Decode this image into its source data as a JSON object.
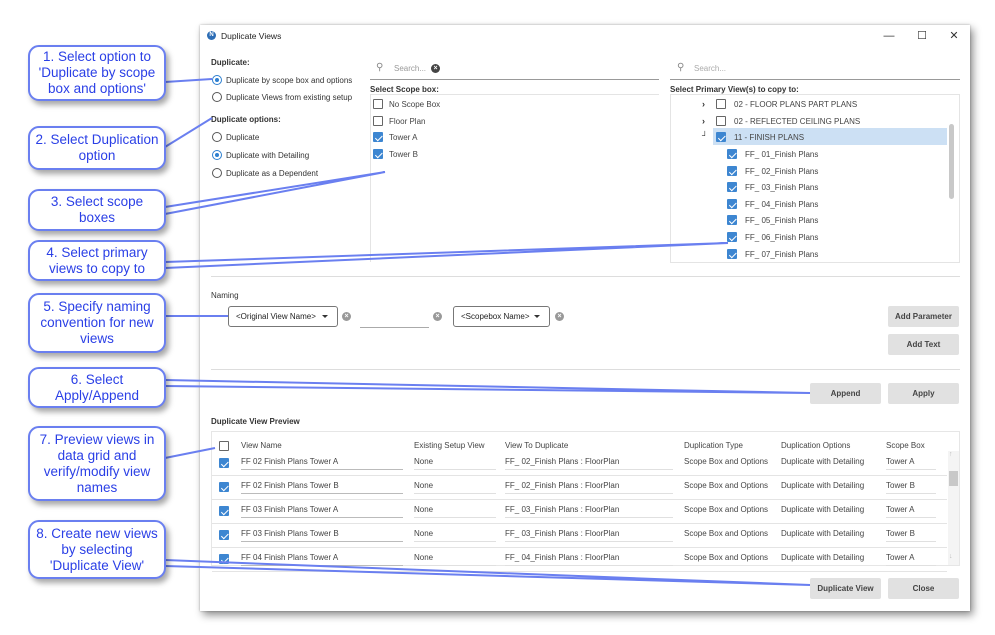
{
  "window": {
    "title": "Duplicate Views",
    "app_icon": "app-logo-icon",
    "controls": {
      "minimize": "—",
      "maximize": "☐",
      "close": "✕"
    }
  },
  "duplicate": {
    "label": "Duplicate:",
    "options": [
      {
        "label": "Duplicate by scope box and options",
        "selected": true
      },
      {
        "label": "Duplicate Views from existing setup",
        "selected": false
      }
    ]
  },
  "duplicate_options": {
    "label": "Duplicate options:",
    "options": [
      {
        "label": "Duplicate",
        "selected": false
      },
      {
        "label": "Duplicate with Detailing",
        "selected": true
      },
      {
        "label": "Duplicate as a Dependent",
        "selected": false
      }
    ]
  },
  "scope_box": {
    "search_placeholder": "Search...",
    "label": "Select Scope box:",
    "items": [
      {
        "label": "No Scope Box",
        "checked": false
      },
      {
        "label": "Floor Plan",
        "checked": false
      },
      {
        "label": "Tower A",
        "checked": true
      },
      {
        "label": "Tower B",
        "checked": true
      }
    ]
  },
  "primary_views": {
    "search_placeholder": "Search...",
    "label": "Select Primary View(s) to copy to:",
    "groups": [
      {
        "label": "02 - FLOOR PLANS PART PLANS",
        "checked": false,
        "expanded": false
      },
      {
        "label": "02 - REFLECTED CEILING PLANS",
        "checked": false,
        "expanded": false
      },
      {
        "label": "11 - FINISH PLANS",
        "checked": true,
        "expanded": true,
        "selected": true
      }
    ],
    "children": [
      {
        "label": "FF_ 01_Finish Plans",
        "checked": true
      },
      {
        "label": "FF_ 02_Finish Plans",
        "checked": true
      },
      {
        "label": "FF_ 03_Finish Plans",
        "checked": true
      },
      {
        "label": "FF_ 04_Finish Plans",
        "checked": true
      },
      {
        "label": "FF_ 05_Finish Plans",
        "checked": true
      },
      {
        "label": "FF_ 06_Finish Plans",
        "checked": true
      },
      {
        "label": "FF_ 07_Finish Plans",
        "checked": true
      }
    ]
  },
  "naming": {
    "label": "Naming",
    "combo1": "<Original View Name>",
    "text_value": "",
    "combo2": "<Scopebox Name>",
    "add_parameter": "Add Parameter",
    "add_text": "Add Text"
  },
  "actions": {
    "append": "Append",
    "apply": "Apply"
  },
  "preview": {
    "label": "Duplicate View Preview",
    "columns": [
      "View Name",
      "Existing Setup View",
      "View To Duplicate",
      "Duplication Type",
      "Duplication Options",
      "Scope Box"
    ],
    "rows": [
      {
        "checked": true,
        "view_name": "FF  02  Finish Plans Tower A",
        "existing": "None",
        "to_duplicate": "FF_ 02_Finish Plans : FloorPlan",
        "type": "Scope Box and Options",
        "options": "Duplicate with Detailing",
        "scope_box": "Tower A"
      },
      {
        "checked": true,
        "view_name": "FF  02  Finish Plans Tower B",
        "existing": "None",
        "to_duplicate": "FF_ 02_Finish Plans : FloorPlan",
        "type": "Scope Box and Options",
        "options": "Duplicate with Detailing",
        "scope_box": "Tower B"
      },
      {
        "checked": true,
        "view_name": "FF  03  Finish Plans Tower A",
        "existing": "None",
        "to_duplicate": "FF_ 03_Finish Plans : FloorPlan",
        "type": "Scope Box and Options",
        "options": "Duplicate with Detailing",
        "scope_box": "Tower A"
      },
      {
        "checked": true,
        "view_name": "FF  03  Finish Plans Tower B",
        "existing": "None",
        "to_duplicate": "FF_ 03_Finish Plans : FloorPlan",
        "type": "Scope Box and Options",
        "options": "Duplicate with Detailing",
        "scope_box": "Tower B"
      },
      {
        "checked": true,
        "view_name": "FF  04  Finish Plans Tower A",
        "existing": "None",
        "to_duplicate": "FF_ 04_Finish Plans : FloorPlan",
        "type": "Scope Box and Options",
        "options": "Duplicate with Detailing",
        "scope_box": "Tower A"
      }
    ]
  },
  "footer": {
    "duplicate_view": "Duplicate View",
    "close": "Close"
  },
  "callouts": [
    "1. Select option to 'Duplicate by scope box and options'",
    "2. Select Duplication option",
    "3. Select scope boxes",
    "4. Select primary views to copy to",
    "5. Specify naming convention for new views",
    "6. Select Apply/Append",
    "7. Preview views in data grid and verify/modify view names",
    "8. Create new views by selecting 'Duplicate View'"
  ],
  "colors": {
    "accent": "#3d86d1",
    "callout": "#2a3fe6",
    "callout_border": "#6a7ff0",
    "tree_selected": "#cce0f4"
  }
}
